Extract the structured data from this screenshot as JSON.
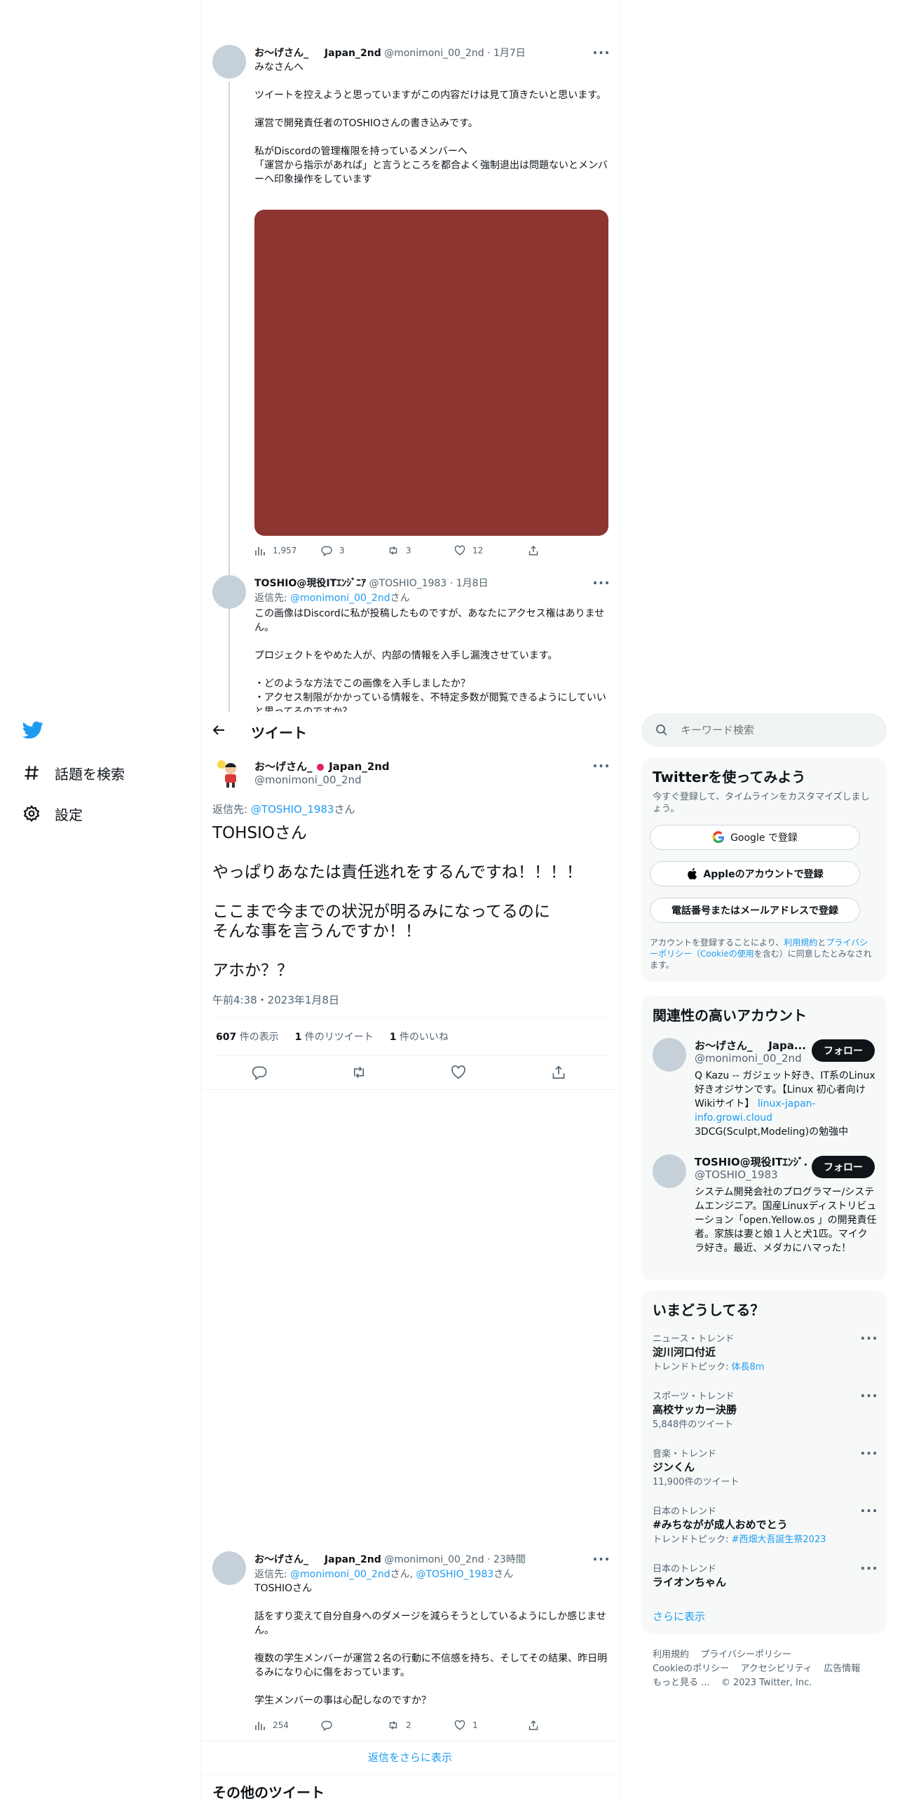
{
  "nav": {
    "items": [
      {
        "label": "話題を検索",
        "icon": "hashtag-icon"
      },
      {
        "label": "設定",
        "icon": "gear-icon"
      }
    ]
  },
  "thread_top": {
    "tweet1": {
      "name": "お〜げさん_",
      "suffix": "Japan_2nd",
      "handle": "@monimoni_00_2nd",
      "date": "1月7日",
      "text": "みなさんへ\n\nツイートを控えようと思っていますがこの内容だけは見て頂きたいと思います。\n\n運営で開発責任者のTOSHIOさんの書き込みです。\n\n私がDiscordの管理権限を持っているメンバーへ\n「運営から指示があれば」と言うところを都合よく強制退出は問題ないとメンバーへ印象操作をしています",
      "views": "1,957",
      "replies": "3",
      "retweets": "3",
      "likes": "12"
    },
    "tweet2": {
      "name": "TOSHIO@現役ITｴﾝｼﾞﾆｱ",
      "handle": "@TOSHIO_1983",
      "date": "1月8日",
      "reply_prefix": "返信先: ",
      "reply_to": "@monimoni_00_2nd",
      "reply_suffix": "さん",
      "text": "この画像はDiscordに私が投稿したものですが、あなたにアクセス権はありません。\n\nプロジェクトをやめた人が、内部の情報を入手し漏洩させています。\n\n・どのような方法でこの画像を入手しましたか？\n・アクセス制限がかかっている情報を、不特定多数が閲覧できるようにしていいと思ってるのですか？"
    }
  },
  "header": {
    "title": "ツイート"
  },
  "main_tweet": {
    "name": "お〜げさん_",
    "suffix": "Japan_2nd",
    "handle": "@monimoni_00_2nd",
    "reply_prefix": "返信先: ",
    "reply_to": "@TOSHIO_1983",
    "reply_suffix": "さん",
    "text": "TOHSIOさん\n\nやっぱりあなたは責任逃れをするんですね！！！！\n\nここまで今までの状況が明るみになってるのに\nそんな事を言うんですか！！\n\nアホか？？",
    "timestamp": "午前4:38・2023年1月8日",
    "views_count": "607",
    "views_label": "件の表示",
    "rt_count": "1",
    "rt_label": "件のリツイート",
    "like_count": "1",
    "like_label": "件のいいね"
  },
  "reply_tweet": {
    "name": "お〜げさん_",
    "suffix": "Japan_2nd",
    "handle": "@monimoni_00_2nd",
    "date": "23時間",
    "reply_prefix": "返信先: ",
    "reply_to1": "@monimoni_00_2nd",
    "reply_mid": "さん, ",
    "reply_to2": "@TOSHIO_1983",
    "reply_suffix": "さん",
    "text": "TOSHIOさん\n\n話をすり変えて自分自身へのダメージを減らそうとしているようにしか感じません。\n\n複数の学生メンバーが運営２名の行動に不信感を持ち、そしてその結果、昨日明るみになり心に傷をおっています。\n\n学生メンバーの事は心配しなのですか？",
    "views": "254",
    "retweets": "2",
    "likes": "1"
  },
  "show_more_replies": "返信をさらに表示",
  "other_tweets": "その他のツイート",
  "search": {
    "placeholder": "キーワード検索"
  },
  "signup": {
    "title": "Twitterを使ってみよう",
    "subtitle": "今すぐ登録して、タイムラインをカスタマイズしましょう。",
    "google": "Google で登録",
    "apple": "Appleのアカウントで登録",
    "phone": "電話番号またはメールアドレスで登録",
    "legal_1": "アカウントを登録することにより、",
    "legal_terms": "利用規約",
    "legal_2": "と",
    "legal_privacy": "プライバシーポリシー（Cookieの使用",
    "legal_3": "を含む）に同意したとみなされます。"
  },
  "related": {
    "title": "関連性の高いアカウント",
    "follow": "フォロー",
    "accounts": [
      {
        "name": "お〜げさん_",
        "suffix": "Japa...",
        "handle": "@monimoni_00_2nd",
        "bio": "Q Kazu -- ガジェット好き、IT系のLinux好きオジサンです。【Linux 初心者向けWikiサイト】",
        "bio_link": "linux-japan-info.growi.cloud",
        "bio_tail": "3DCG(Sculpt,Modeling)の勉強中"
      },
      {
        "name": "TOSHIO@現役ITｴﾝｼﾞ...",
        "handle": "@TOSHIO_1983",
        "bio": "システム開発会社のプログラマー/システムエンジニア。国産Linuxディストリビューション「open.Yellow.os 」の開発責任者。家族は妻と娘１人と犬1匹。マイクラ好き。最近、メダカにハマった！"
      }
    ]
  },
  "trends": {
    "title": "いまどうしてる？",
    "items": [
      {
        "cat": "ニュース・トレンド",
        "name": "淀川河口付近",
        "sub_prefix": "トレンドトピック: ",
        "sub_link": "体長8m"
      },
      {
        "cat": "スポーツ・トレンド",
        "name": "高校サッカー決勝",
        "sub": "5,848件のツイート"
      },
      {
        "cat": "音楽・トレンド",
        "name": "ジンくん",
        "sub": "11,900件のツイート"
      },
      {
        "cat": "日本のトレンド",
        "name": "#みちながが成人おめでとう",
        "sub_prefix": "トレンドトピック: ",
        "sub_link": "#西畑大吾誕生祭2023"
      },
      {
        "cat": "日本のトレンド",
        "name": "ライオンちゃん"
      }
    ],
    "show_more": "さらに表示"
  },
  "footer": {
    "terms": "利用規約",
    "privacy": "プライバシーポリシー",
    "cookie": "Cookieのポリシー",
    "accessibility": "アクセシビリティ",
    "ads": "広告情報",
    "more": "もっと見る ...",
    "copyright": "© 2023 Twitter, Inc."
  },
  "colors": {
    "accent": "#1d9bf0",
    "image_placeholder": "#8c3531",
    "text": "#0f1419",
    "muted": "#536471"
  }
}
